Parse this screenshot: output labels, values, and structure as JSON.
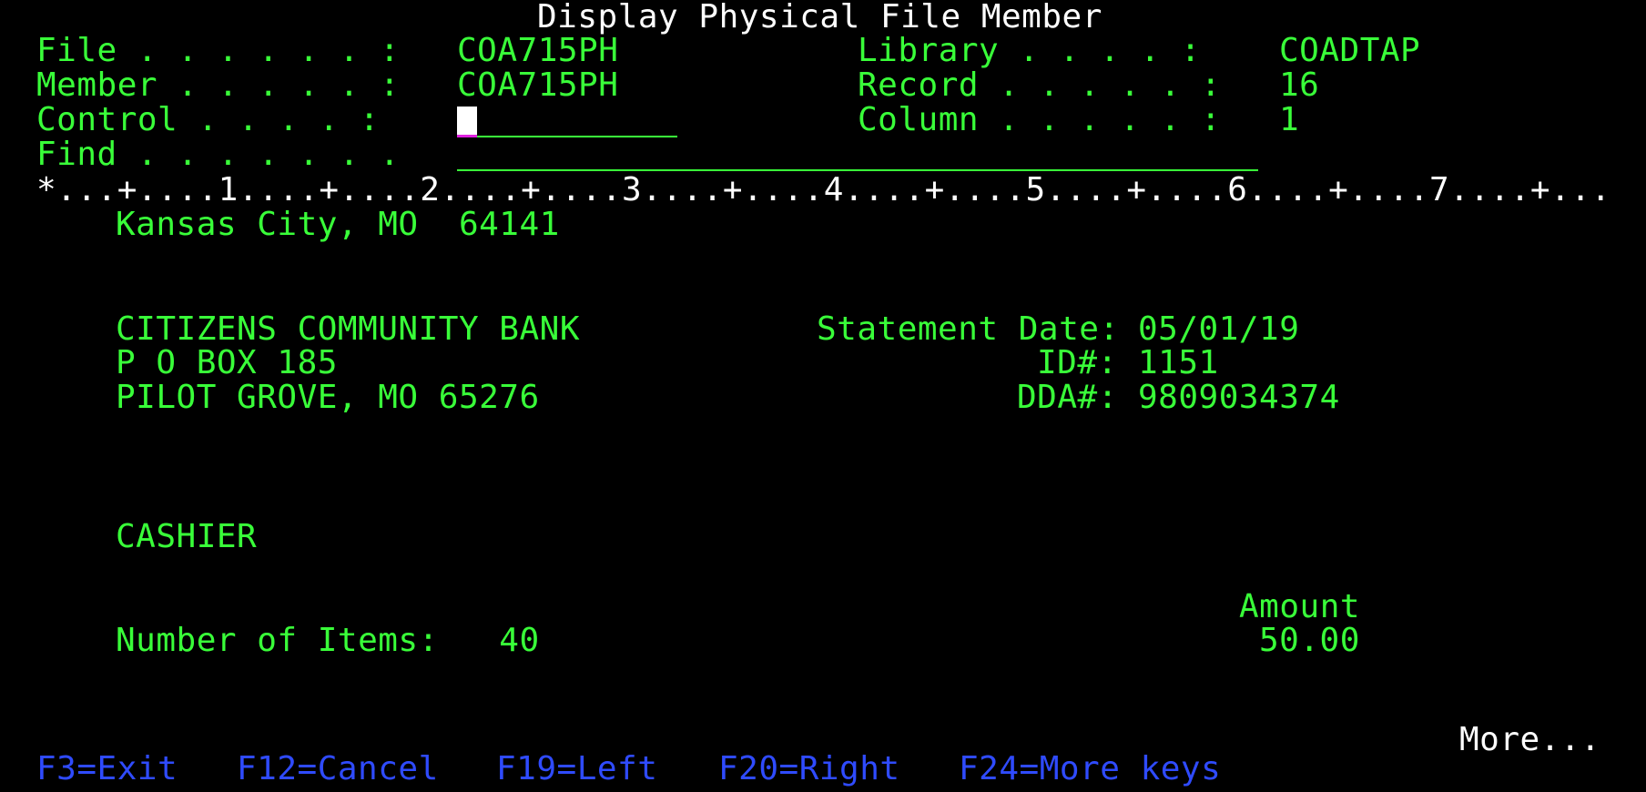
{
  "screen_title": "Display Physical File Member",
  "header": {
    "file_label": "File . . . . . . :",
    "file_value": "COA715PH",
    "member_label": "Member . . . . . :",
    "member_value": "COA715PH",
    "control_label": "Control . . . . :",
    "find_label": "Find . . . . . . .",
    "library_label": "Library . . . . :",
    "library_value": "COADTAP",
    "record_label": "Record . . . . . :",
    "record_value": "16",
    "column_label": "Column . . . . . :",
    "column_value": "1"
  },
  "ruler": "*...+....1....+....2....+....3....+....4....+....5....+....6....+....7....+...",
  "record_lines": {
    "line_kansas_city": "Kansas City, MO  64141",
    "bank_name": "CITIZENS COMMUNITY BANK",
    "po_box": "P O BOX 185",
    "city": "PILOT GROVE, MO 65276",
    "statement_date_label": "Statement Date:",
    "statement_date_value": "05/01/19",
    "id_label": "ID#:",
    "id_value": "1151",
    "dda_label": "DDA#:",
    "dda_value": "9809034374",
    "cashier": "CASHIER",
    "items_label": "Number of Items:   40",
    "amount_label": "Amount",
    "amount_value": "50.00"
  },
  "more_indicator": "More...",
  "function_keys": [
    "F3=Exit",
    "F12=Cancel",
    "F19=Left",
    "F20=Right",
    "F24=More keys"
  ],
  "colors": {
    "background": "#000000",
    "field_text": "#39ff39",
    "heading_text": "#ffffff",
    "function_key_text": "#2f4bff",
    "cursor_underline": "#e020e0"
  }
}
